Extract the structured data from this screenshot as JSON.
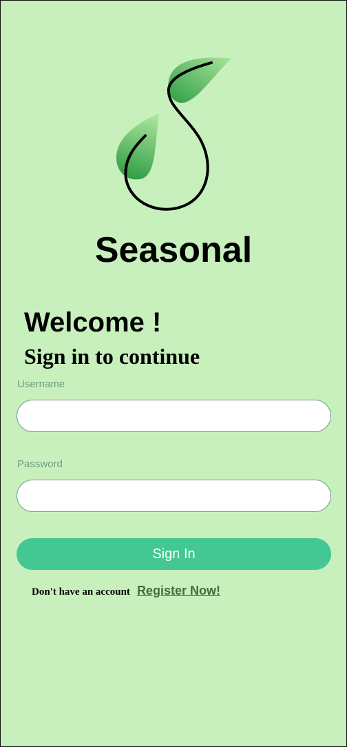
{
  "app": {
    "name": "Seasonal",
    "logo_icon": "sprout-leaf-icon"
  },
  "login": {
    "welcome": "Welcome !",
    "subtitle": "Sign in to continue",
    "username_label": "Username",
    "username_value": "",
    "password_label": "Password",
    "password_value": "",
    "signin_label": "Sign In",
    "register_prompt": "Don't have an account",
    "register_link": "Register Now!"
  },
  "colors": {
    "background": "#c8f0bd",
    "button": "#43c893",
    "button_text": "#ffffff",
    "label": "#6a9e82",
    "link": "#3e6e3e",
    "leaf_light": "#8fd67f",
    "leaf_dark": "#2f9e45"
  }
}
